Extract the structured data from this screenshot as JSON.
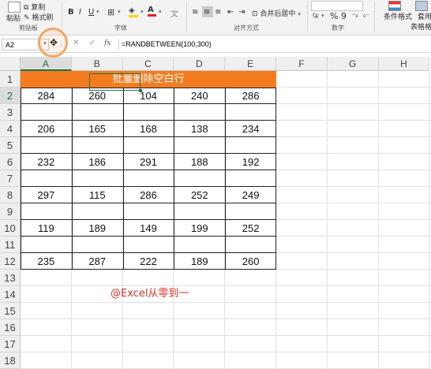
{
  "ribbon": {
    "paste_label": "粘贴",
    "copy_label": "复制",
    "format_painter_label": "格式刷",
    "clipboard_group": "剪贴板",
    "font_group": "字体",
    "align_group": "对齐方式",
    "number_group": "数字",
    "bold": "B",
    "italic": "I",
    "underline": "U",
    "merge_center": "合并后居中",
    "percent": "%",
    "comma": "9",
    "conditional_format": "条件格式",
    "table_format_line1": "套用",
    "table_format_line2": "表格格式"
  },
  "formula_bar": {
    "name_box": "A2",
    "fx": "fx",
    "formula": "=RANDBETWEEN(100,300)"
  },
  "columns": [
    "A",
    "B",
    "C",
    "D",
    "E",
    "F",
    "G",
    "H"
  ],
  "rows": [
    "1",
    "2",
    "3",
    "4",
    "5",
    "6",
    "7",
    "8",
    "9",
    "10",
    "11",
    "12",
    "13",
    "14",
    "15",
    "16",
    "17",
    "18"
  ],
  "sheet": {
    "title": "批量删除空白行",
    "data_rows": [
      {
        "row": 2,
        "values": [
          "284",
          "260",
          "104",
          "240",
          "286"
        ]
      },
      {
        "row": 4,
        "values": [
          "206",
          "165",
          "168",
          "138",
          "234"
        ]
      },
      {
        "row": 6,
        "values": [
          "232",
          "186",
          "291",
          "188",
          "192"
        ]
      },
      {
        "row": 8,
        "values": [
          "297",
          "115",
          "286",
          "252",
          "249"
        ]
      },
      {
        "row": 10,
        "values": [
          "119",
          "189",
          "149",
          "199",
          "252"
        ]
      },
      {
        "row": 12,
        "values": [
          "235",
          "287",
          "222",
          "189",
          "260"
        ]
      }
    ],
    "watermark": "@Excel从零到一"
  },
  "colors": {
    "title_fill": "#f47c20",
    "selection": "#217346",
    "watermark": "#e0302a"
  }
}
